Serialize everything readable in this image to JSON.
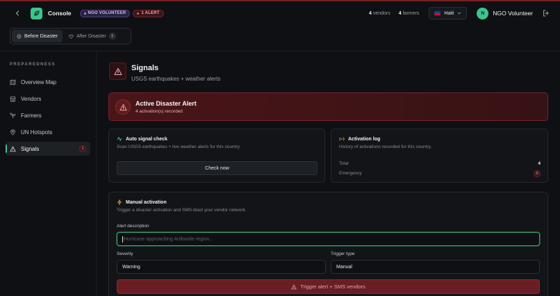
{
  "header": {
    "app_title": "Console",
    "role_badge": "NGO VOLUNTEER",
    "alert_badge": "1 ALERT",
    "vendors_count": "4",
    "vendors_label": "vendors",
    "farmers_count": "4",
    "farmers_label": "farmers",
    "country": "Haiti",
    "user_initial": "N",
    "user_name": "NGO Volunteer"
  },
  "mode_tabs": [
    {
      "label": "Before Disaster",
      "active": true
    },
    {
      "label": "After Disaster",
      "count": "1",
      "active": false
    }
  ],
  "sidebar": {
    "section_label": "PREPAREDNESS",
    "items": [
      {
        "label": "Overview Map",
        "icon": "map-icon"
      },
      {
        "label": "Vendors",
        "icon": "store-icon"
      },
      {
        "label": "Farmers",
        "icon": "sprout-icon"
      },
      {
        "label": "UN Hotspots",
        "icon": "pin-icon"
      },
      {
        "label": "Signals",
        "icon": "warning-icon",
        "badge": "1",
        "active": true
      }
    ]
  },
  "page": {
    "title": "Signals",
    "subtitle": "USGS earthquakes + weather alerts"
  },
  "alert_banner": {
    "title": "Active Disaster Alert",
    "subtitle": "4 activation(s) recorded"
  },
  "auto_check": {
    "title": "Auto signal check",
    "description": "Scan USGS earthquakes + live weather alerts for this country.",
    "button_label": "Check now"
  },
  "activation_log": {
    "title": "Activation log",
    "description": "History of activations recorded for this country.",
    "rows": [
      {
        "label": "Total",
        "value": "4"
      },
      {
        "label": "Emergency",
        "value": "0"
      }
    ]
  },
  "manual": {
    "title": "Manual activation",
    "description": "Trigger a disaster activation and SMS-blast your vendor network.",
    "alert_description_label": "Alert description",
    "alert_description_placeholder": "Hurricane approaching Artibonite region...",
    "severity_label": "Severity",
    "severity_value": "Warning",
    "trigger_type_label": "Trigger type",
    "trigger_type_value": "Manual",
    "submit_label": "Trigger alert + SMS vendors"
  },
  "colors": {
    "accent": "#3ec48f",
    "danger": "#7a2229",
    "background": "#0e1013"
  }
}
